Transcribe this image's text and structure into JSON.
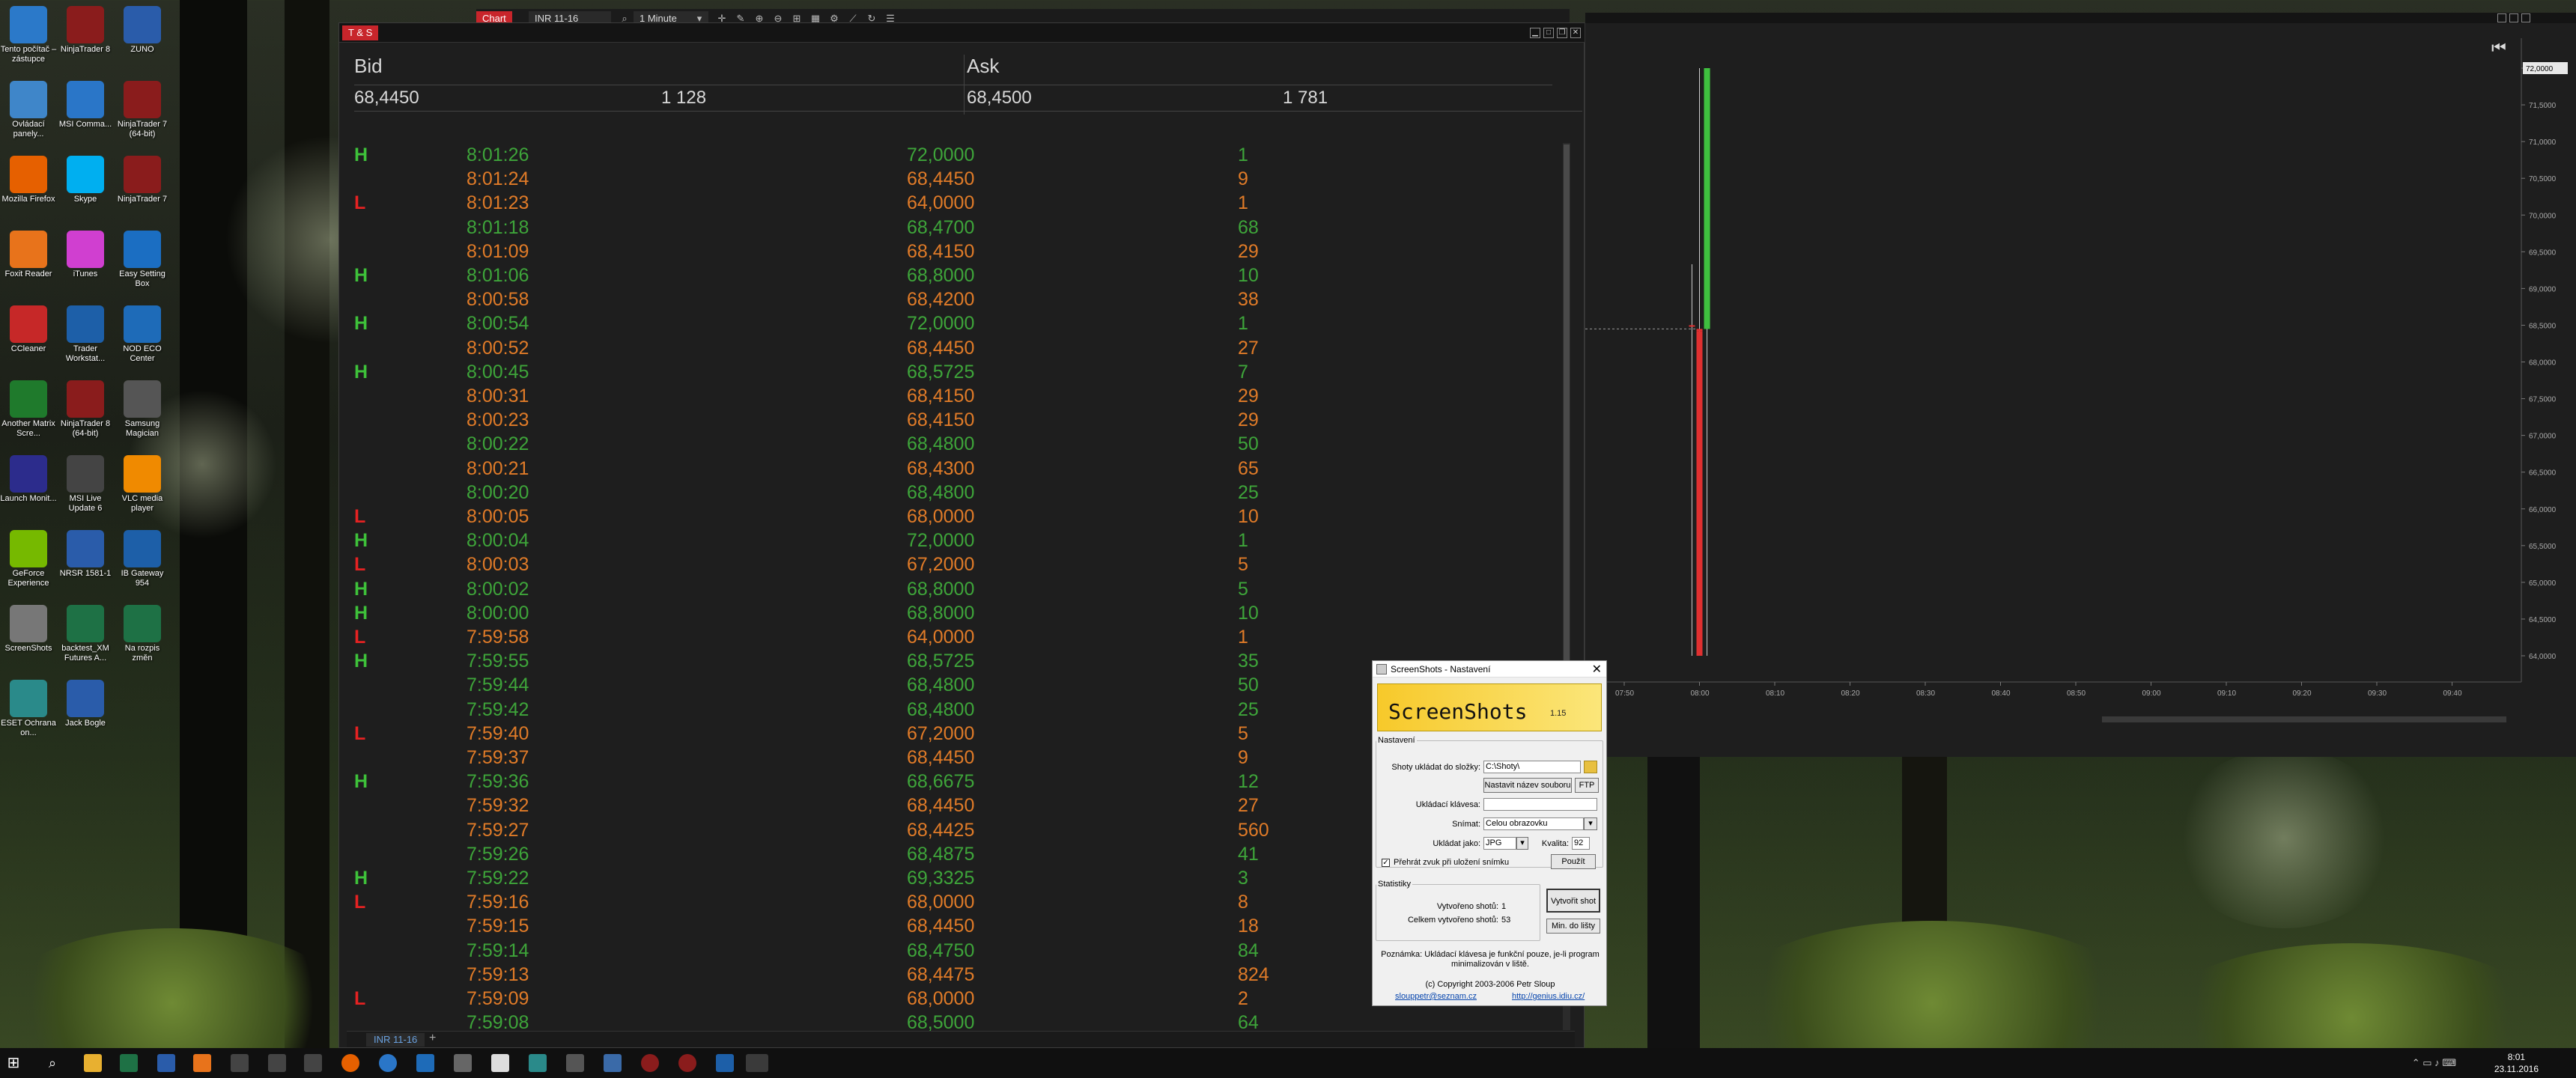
{
  "desktop": {
    "icons": [
      {
        "label": "Tento počítač – zástupce",
        "icon": "computer-icon",
        "color": "#2b79c9"
      },
      {
        "label": "NinjaTrader 8",
        "icon": "ninjatrader-icon",
        "color": "#8a1c1c"
      },
      {
        "label": "ZUNO",
        "icon": "word-doc-icon",
        "color": "#2a5caa"
      },
      {
        "label": "Ovládací panely...",
        "icon": "control-panel-icon",
        "color": "#3f86c9"
      },
      {
        "label": "MSI Comma...",
        "icon": "msi-icon",
        "color": "#2a76c8"
      },
      {
        "label": "NinjaTrader 7 (64-bit)",
        "icon": "ninjatrader-icon",
        "color": "#8a1c1c"
      },
      {
        "label": "Mozilla Firefox",
        "icon": "firefox-icon",
        "color": "#e66000"
      },
      {
        "label": "Skype",
        "icon": "skype-icon",
        "color": "#00aff0"
      },
      {
        "label": "NinjaTrader 7",
        "icon": "ninjatrader-icon",
        "color": "#8a1c1c"
      },
      {
        "label": "Foxit Reader",
        "icon": "foxit-icon",
        "color": "#e8731b"
      },
      {
        "label": "iTunes",
        "icon": "itunes-icon",
        "color": "#d03fd0"
      },
      {
        "label": "Easy Setting Box",
        "icon": "windows-icon",
        "color": "#1b6ec2"
      },
      {
        "label": "CCleaner",
        "icon": "ccleaner-icon",
        "color": "#c62828"
      },
      {
        "label": "Trader Workstat...",
        "icon": "tws-icon",
        "color": "#1d5fa8"
      },
      {
        "label": "NOD ECO Center",
        "icon": "eco-icon",
        "color": "#1e6bb8"
      },
      {
        "label": "Another Matrix Scre...",
        "icon": "matrix-icon",
        "color": "#1f7a2c"
      },
      {
        "label": "NinjaTrader 8 (64-bit)",
        "icon": "ninjatrader-icon",
        "color": "#8a1c1c"
      },
      {
        "label": "Samsung Magician",
        "icon": "samsung-icon",
        "color": "#555555"
      },
      {
        "label": "Launch Monit...",
        "icon": "monitor-icon",
        "color": "#2c2c8c"
      },
      {
        "label": "MSI Live Update 6",
        "icon": "msi-live-icon",
        "color": "#444444"
      },
      {
        "label": "VLC media player",
        "icon": "vlc-icon",
        "color": "#f08a00"
      },
      {
        "label": "GeForce Experience",
        "icon": "geforce-icon",
        "color": "#76b900"
      },
      {
        "label": "NRSR 1581-1",
        "icon": "word-doc-icon",
        "color": "#2a5caa"
      },
      {
        "label": "IB Gateway 954",
        "icon": "api-icon",
        "color": "#1d5fa8"
      },
      {
        "label": "ScreenShots",
        "icon": "camera-icon",
        "color": "#777777"
      },
      {
        "label": "backtest_XM Futures A...",
        "icon": "excel-icon",
        "color": "#1e7145"
      },
      {
        "label": "Na rozpis změn",
        "icon": "excel-icon",
        "color": "#1e7145"
      },
      {
        "label": "ESET Ochrana on...",
        "icon": "eset-icon",
        "color": "#2a8a8a"
      },
      {
        "label": "Jack Bogle",
        "icon": "word-doc-icon",
        "color": "#2a5caa"
      }
    ]
  },
  "toolbar": {
    "chart_tab": "Chart",
    "instrument": "INR 11-16",
    "interval": "1 Minute"
  },
  "ts_window": {
    "tab": "T & S",
    "bid_label": "Bid",
    "ask_label": "Ask",
    "bid_price": "68,4450",
    "bid_size": "1 128",
    "ask_price": "68,4500",
    "ask_size": "1 781",
    "bottom_tab": "INR 11-16",
    "rows": [
      {
        "flag": "H",
        "time": "8:01:26",
        "price": "72,0000",
        "size": "1",
        "color": "green"
      },
      {
        "flag": "",
        "time": "8:01:24",
        "price": "68,4450",
        "size": "9",
        "color": "orange"
      },
      {
        "flag": "L",
        "time": "8:01:23",
        "price": "64,0000",
        "size": "1",
        "color": "orange"
      },
      {
        "flag": "",
        "time": "8:01:18",
        "price": "68,4700",
        "size": "68",
        "color": "green"
      },
      {
        "flag": "",
        "time": "8:01:09",
        "price": "68,4150",
        "size": "29",
        "color": "orange"
      },
      {
        "flag": "H",
        "time": "8:01:06",
        "price": "68,8000",
        "size": "10",
        "color": "green"
      },
      {
        "flag": "",
        "time": "8:00:58",
        "price": "68,4200",
        "size": "38",
        "color": "orange"
      },
      {
        "flag": "H",
        "time": "8:00:54",
        "price": "72,0000",
        "size": "1",
        "color": "green"
      },
      {
        "flag": "",
        "time": "8:00:52",
        "price": "68,4450",
        "size": "27",
        "color": "orange"
      },
      {
        "flag": "H",
        "time": "8:00:45",
        "price": "68,5725",
        "size": "7",
        "color": "green"
      },
      {
        "flag": "",
        "time": "8:00:31",
        "price": "68,4150",
        "size": "29",
        "color": "orange"
      },
      {
        "flag": "",
        "time": "8:00:23",
        "price": "68,4150",
        "size": "29",
        "color": "orange"
      },
      {
        "flag": "",
        "time": "8:00:22",
        "price": "68,4800",
        "size": "50",
        "color": "green"
      },
      {
        "flag": "",
        "time": "8:00:21",
        "price": "68,4300",
        "size": "65",
        "color": "orange"
      },
      {
        "flag": "",
        "time": "8:00:20",
        "price": "68,4800",
        "size": "25",
        "color": "green"
      },
      {
        "flag": "L",
        "time": "8:00:05",
        "price": "68,0000",
        "size": "10",
        "color": "orange"
      },
      {
        "flag": "H",
        "time": "8:00:04",
        "price": "72,0000",
        "size": "1",
        "color": "green"
      },
      {
        "flag": "L",
        "time": "8:00:03",
        "price": "67,2000",
        "size": "5",
        "color": "orange"
      },
      {
        "flag": "H",
        "time": "8:00:02",
        "price": "68,8000",
        "size": "5",
        "color": "green"
      },
      {
        "flag": "H",
        "time": "8:00:00",
        "price": "68,8000",
        "size": "10",
        "color": "green"
      },
      {
        "flag": "L",
        "time": "7:59:58",
        "price": "64,0000",
        "size": "1",
        "color": "orange"
      },
      {
        "flag": "H",
        "time": "7:59:55",
        "price": "68,5725",
        "size": "35",
        "color": "green"
      },
      {
        "flag": "",
        "time": "7:59:44",
        "price": "68,4800",
        "size": "50",
        "color": "green"
      },
      {
        "flag": "",
        "time": "7:59:42",
        "price": "68,4800",
        "size": "25",
        "color": "green"
      },
      {
        "flag": "L",
        "time": "7:59:40",
        "price": "67,2000",
        "size": "5",
        "color": "orange"
      },
      {
        "flag": "",
        "time": "7:59:37",
        "price": "68,4450",
        "size": "9",
        "color": "orange"
      },
      {
        "flag": "H",
        "time": "7:59:36",
        "price": "68,6675",
        "size": "12",
        "color": "green"
      },
      {
        "flag": "",
        "time": "7:59:32",
        "price": "68,4450",
        "size": "27",
        "color": "orange"
      },
      {
        "flag": "",
        "time": "7:59:27",
        "price": "68,4425",
        "size": "560",
        "color": "orange"
      },
      {
        "flag": "",
        "time": "7:59:26",
        "price": "68,4875",
        "size": "41",
        "color": "green"
      },
      {
        "flag": "H",
        "time": "7:59:22",
        "price": "69,3325",
        "size": "3",
        "color": "green"
      },
      {
        "flag": "L",
        "time": "7:59:16",
        "price": "68,0000",
        "size": "8",
        "color": "orange"
      },
      {
        "flag": "",
        "time": "7:59:15",
        "price": "68,4450",
        "size": "18",
        "color": "orange"
      },
      {
        "flag": "",
        "time": "7:59:14",
        "price": "68,4750",
        "size": "84",
        "color": "green"
      },
      {
        "flag": "",
        "time": "7:59:13",
        "price": "68,4475",
        "size": "824",
        "color": "orange"
      },
      {
        "flag": "L",
        "time": "7:59:09",
        "price": "68,0000",
        "size": "2",
        "color": "orange"
      },
      {
        "flag": "",
        "time": "7:59:08",
        "price": "68,5000",
        "size": "64",
        "color": "green"
      }
    ]
  },
  "chart_data": {
    "type": "candlestick",
    "y_ticks": [
      "72,0000",
      "71,5000",
      "71,0000",
      "70,5000",
      "70,0000",
      "69,5000",
      "69,0000",
      "68,5000",
      "68,0000",
      "67,5000",
      "67,0000",
      "66,5000",
      "66,0000",
      "65,5000",
      "65,0000",
      "64,5000",
      "64,0000"
    ],
    "ylim": [
      64.0,
      72.0
    ],
    "x_ticks": [
      "07:50",
      "08:00",
      "08:10",
      "08:20",
      "08:30",
      "08:40",
      "08:50",
      "09:00",
      "09:10",
      "09:20",
      "09:30",
      "09:40"
    ],
    "last_price_label": "72,0000",
    "candles": [
      {
        "time": "07:59",
        "open": 68.5,
        "high": 69.33,
        "low": 64.0,
        "close": 68.5,
        "color": "red"
      },
      {
        "time": "08:00",
        "open": 68.42,
        "high": 72.0,
        "low": 64.0,
        "close": 68.45,
        "color": "red"
      },
      {
        "time": "08:01",
        "open": 68.45,
        "high": 72.0,
        "low": 64.0,
        "close": 72.0,
        "color": "green"
      }
    ],
    "colors": {
      "up": "#3fbf3f",
      "down": "#e03030"
    }
  },
  "screenshots_dialog": {
    "title": "ScreenShots - Nastavení",
    "banner_title": "ScreenShots",
    "banner_version": "1.15",
    "group_settings": "Nastavení",
    "save_folder_label": "Shoty ukládat do složky:",
    "save_folder_value": "C:\\Shoty\\",
    "set_filename_button": "Nastavit název souboru",
    "ftp_button": "FTP",
    "save_key_label": "Ukládací klávesa:",
    "capture_label": "Snímat:",
    "capture_value": "Celou obrazovku",
    "save_as_label": "Ukládat jako:",
    "format_value": "JPG",
    "quality_label": "Kvalita:",
    "quality_value": "92",
    "sound_checkbox": "Přehrát zvuk při uložení snímku",
    "apply_button": "Použít",
    "group_stats": "Statistiky",
    "shots_created_label": "Vytvořeno shotů:",
    "shots_created_value": "1",
    "shots_total_label": "Celkem vytvořeno shotů:",
    "shots_total_value": "53",
    "create_shot_button": "Vytvořit shot",
    "minimize_button": "Min. do lišty",
    "note": "Poznámka: Ukládací klávesa je funkční pouze, je-li program minimalizován v liště.",
    "copyright": "(c) Copyright 2003-2006 Petr Sloup",
    "email": "slouppetr@seznam.cz",
    "website": "http://genius.idiu.cz/"
  },
  "taskbar": {
    "time": "8:01",
    "date": "23.11.2016"
  }
}
